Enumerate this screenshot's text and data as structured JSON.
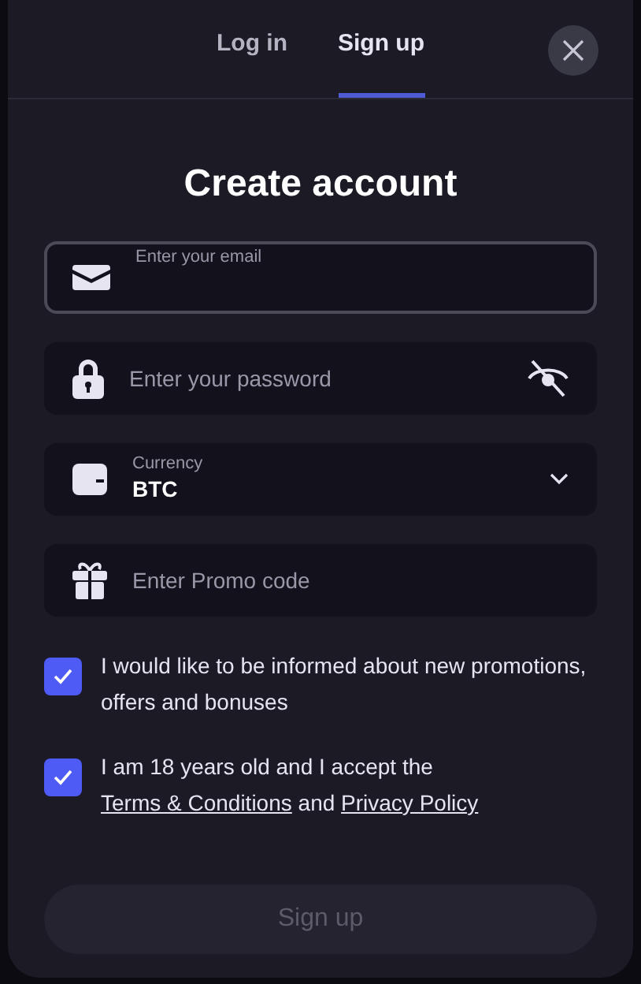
{
  "tabs": [
    {
      "label": "Log in",
      "selected": false
    },
    {
      "label": "Sign up",
      "selected": true
    }
  ],
  "title": "Create account",
  "fields": [
    {
      "kind": "email",
      "label": "Enter your email",
      "focused": true
    },
    {
      "kind": "password",
      "placeholder": "Enter your password"
    },
    {
      "kind": "select",
      "label": "Currency",
      "value": "BTC"
    },
    {
      "kind": "promo",
      "placeholder": "Enter Promo code"
    }
  ],
  "agreements": [
    {
      "checked": true,
      "parts": [
        {
          "kind": "text",
          "text": "I would like to be informed about new promotions, offers and bonuses"
        }
      ]
    },
    {
      "checked": true,
      "parts": [
        {
          "kind": "text",
          "text": "I am 18 years old and I accept the "
        },
        {
          "kind": "link",
          "text": "Terms & Conditions"
        },
        {
          "kind": "text",
          "text": " and "
        },
        {
          "kind": "link",
          "text": "Privacy Policy"
        }
      ]
    }
  ],
  "submit": {
    "label": "Sign up",
    "disabled": true
  }
}
